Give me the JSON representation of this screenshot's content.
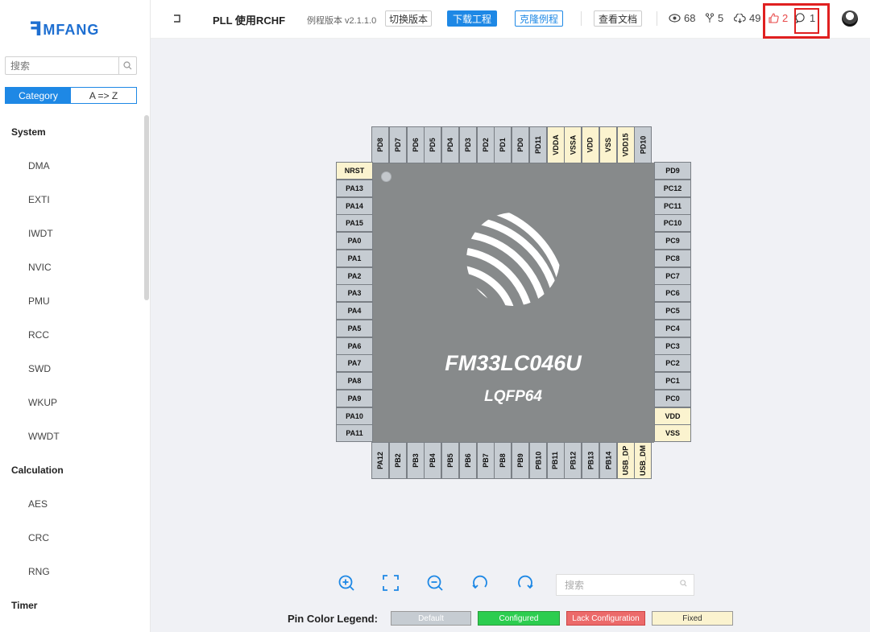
{
  "logo": {
    "text": "MFANG",
    "mark": "ꟻ"
  },
  "sidebar": {
    "search_placeholder": "搜索",
    "tabs": [
      {
        "label": "Category",
        "active": true
      },
      {
        "label": "A => Z",
        "active": false
      }
    ],
    "groups": [
      {
        "label": "System",
        "items": [
          "DMA",
          "EXTI",
          "IWDT",
          "NVIC",
          "PMU",
          "RCC",
          "SWD",
          "WKUP",
          "WWDT"
        ]
      },
      {
        "label": "Calculation",
        "items": [
          "AES",
          "CRC",
          "RNG"
        ]
      },
      {
        "label": "Timer",
        "items": []
      }
    ]
  },
  "header": {
    "title": "PLL 使用RCHF",
    "version": "例程版本 v2.1.1.0",
    "switch_label": "切换版本",
    "download_label": "下载工程",
    "clone_label": "克隆例程",
    "docs_label": "查看文档",
    "views": "68",
    "forks": "5",
    "downloads": "49",
    "likes": "2",
    "comments": "1"
  },
  "chip": {
    "name": "FM33LC046U",
    "package": "LQFP64",
    "pins_top": [
      {
        "label": "PD8",
        "fixed": false
      },
      {
        "label": "PD7",
        "fixed": false
      },
      {
        "label": "PD6",
        "fixed": false
      },
      {
        "label": "PD5",
        "fixed": false
      },
      {
        "label": "PD4",
        "fixed": false
      },
      {
        "label": "PD3",
        "fixed": false
      },
      {
        "label": "PD2",
        "fixed": false
      },
      {
        "label": "PD1",
        "fixed": false
      },
      {
        "label": "PD0",
        "fixed": false
      },
      {
        "label": "PD11",
        "fixed": false
      },
      {
        "label": "VDDA",
        "fixed": true
      },
      {
        "label": "VSSA",
        "fixed": true
      },
      {
        "label": "VDD",
        "fixed": true
      },
      {
        "label": "VSS",
        "fixed": true
      },
      {
        "label": "VDD15",
        "fixed": true
      },
      {
        "label": "PD10",
        "fixed": false
      }
    ],
    "pins_left": [
      {
        "label": "NRST",
        "fixed": true
      },
      {
        "label": "PA13",
        "fixed": false
      },
      {
        "label": "PA14",
        "fixed": false
      },
      {
        "label": "PA15",
        "fixed": false
      },
      {
        "label": "PA0",
        "fixed": false
      },
      {
        "label": "PA1",
        "fixed": false
      },
      {
        "label": "PA2",
        "fixed": false
      },
      {
        "label": "PA3",
        "fixed": false
      },
      {
        "label": "PA4",
        "fixed": false
      },
      {
        "label": "PA5",
        "fixed": false
      },
      {
        "label": "PA6",
        "fixed": false
      },
      {
        "label": "PA7",
        "fixed": false
      },
      {
        "label": "PA8",
        "fixed": false
      },
      {
        "label": "PA9",
        "fixed": false
      },
      {
        "label": "PA10",
        "fixed": false
      },
      {
        "label": "PA11",
        "fixed": false
      }
    ],
    "pins_right": [
      {
        "label": "PD9",
        "fixed": false
      },
      {
        "label": "PC12",
        "fixed": false
      },
      {
        "label": "PC11",
        "fixed": false
      },
      {
        "label": "PC10",
        "fixed": false
      },
      {
        "label": "PC9",
        "fixed": false
      },
      {
        "label": "PC8",
        "fixed": false
      },
      {
        "label": "PC7",
        "fixed": false
      },
      {
        "label": "PC6",
        "fixed": false
      },
      {
        "label": "PC5",
        "fixed": false
      },
      {
        "label": "PC4",
        "fixed": false
      },
      {
        "label": "PC3",
        "fixed": false
      },
      {
        "label": "PC2",
        "fixed": false
      },
      {
        "label": "PC1",
        "fixed": false
      },
      {
        "label": "PC0",
        "fixed": false
      },
      {
        "label": "VDD",
        "fixed": true
      },
      {
        "label": "VSS",
        "fixed": true
      }
    ],
    "pins_bottom": [
      {
        "label": "PA12",
        "fixed": false
      },
      {
        "label": "PB2",
        "fixed": false
      },
      {
        "label": "PB3",
        "fixed": false
      },
      {
        "label": "PB4",
        "fixed": false
      },
      {
        "label": "PB5",
        "fixed": false
      },
      {
        "label": "PB6",
        "fixed": false
      },
      {
        "label": "PB7",
        "fixed": false
      },
      {
        "label": "PB8",
        "fixed": false
      },
      {
        "label": "PB9",
        "fixed": false
      },
      {
        "label": "PB10",
        "fixed": false
      },
      {
        "label": "PB11",
        "fixed": false
      },
      {
        "label": "PB12",
        "fixed": false
      },
      {
        "label": "PB13",
        "fixed": false
      },
      {
        "label": "PB14",
        "fixed": false
      },
      {
        "label": "USB_DP",
        "fixed": true
      },
      {
        "label": "USB_DM",
        "fixed": true
      }
    ]
  },
  "toolbar": {
    "search_placeholder": "搜索"
  },
  "legend": {
    "label": "Pin Color Legend:",
    "default": "Default",
    "configured": "Configured",
    "lack": "Lack Configuration",
    "fixed": "Fixed"
  },
  "colors": {
    "accent": "#1e88e5",
    "highlight": "#e02020",
    "chip": "#878a8b",
    "pin": "#c6ccd2",
    "pin_fixed": "#fbf3cf"
  }
}
